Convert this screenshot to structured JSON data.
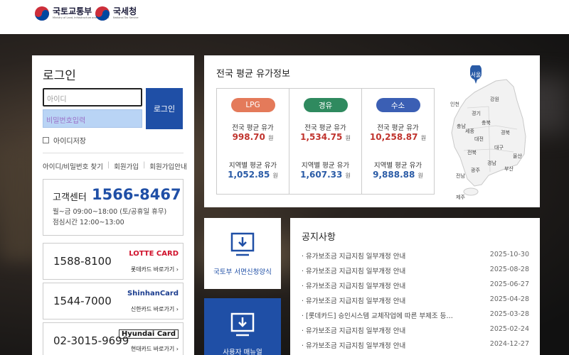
{
  "header": {
    "logo1": {
      "title": "국토교통부",
      "sub": "Ministry of Land, Infrastructure and Transport"
    },
    "logo2": {
      "title": "국세청",
      "sub": "National Tax Service"
    }
  },
  "login": {
    "title": "로그인",
    "id_placeholder": "아이디",
    "pw_placeholder": "비밀번호입력",
    "login_button": "로그인",
    "save_id_label": "아이디저장",
    "links": [
      "아이디/비밀번호 찾기",
      "회원가입",
      "회원가입안내"
    ]
  },
  "customer_center": {
    "label": "고객센터",
    "number": "1566-8467",
    "hours": "월~금 09:00~18:00 (토/공휴일 휴무)",
    "lunch": "점심시간 12:00~13:00"
  },
  "cards": [
    {
      "number": "1588-8100",
      "brand": "LOTTE CARD",
      "shortcut": "롯데카드 바로가기 ›",
      "color": "#d0112b"
    },
    {
      "number": "1544-7000",
      "brand": "ShinhanCard",
      "shortcut": "신한카드 바로가기 ›",
      "color": "#1a3c8e"
    },
    {
      "number": "02-3015-9699",
      "brand": "Hyundai Card",
      "shortcut": "현대카드 바로가기 ›",
      "color": "#111111"
    }
  ],
  "price": {
    "title": "전국 평균 유가정보",
    "fuels": [
      {
        "name": "LPG",
        "color": "#e47a5a",
        "national_label": "전국 평균 유가",
        "national_value": "998.70",
        "regional_label": "지역별 평균 유가",
        "regional_value": "1,052.85",
        "unit": "원"
      },
      {
        "name": "경유",
        "color": "#2f8a5f",
        "national_label": "전국 평균 유가",
        "national_value": "1,534.75",
        "regional_label": "지역별 평균 유가",
        "regional_value": "1,607.33",
        "unit": "원"
      },
      {
        "name": "수소",
        "color": "#3b5fb4",
        "national_label": "전국 평균 유가",
        "national_value": "10,258.87",
        "regional_label": "지역별 평균 유가",
        "regional_value": "9,888.88",
        "unit": "원"
      }
    ],
    "map": {
      "selected": "서울",
      "regions": [
        "인천",
        "강원",
        "경기",
        "충북",
        "충남",
        "세종",
        "대전",
        "경북",
        "대구",
        "전북",
        "울산",
        "광주",
        "경남",
        "부산",
        "전남",
        "제주"
      ]
    }
  },
  "tiles": [
    {
      "label": "국토부 서면신청양식",
      "icon": "download-monitor-icon"
    },
    {
      "label": "사용자 매뉴얼",
      "icon": "download-monitor-icon"
    }
  ],
  "notice": {
    "title": "공지사항",
    "items": [
      {
        "title": "유가보조금 지급지침 일부개정 안내",
        "date": "2025-10-30"
      },
      {
        "title": "유가보조금 지급지침 일부개정 안내",
        "date": "2025-08-28"
      },
      {
        "title": "유가보조금 지급지침 일부개정 안내",
        "date": "2025-06-27"
      },
      {
        "title": "유가보조금 지급지침 일부개정 안내",
        "date": "2025-04-28"
      },
      {
        "title": "[롯데카드] 승인시스템 교체작업에 따른 부제조 등…",
        "date": "2025-03-28"
      },
      {
        "title": "유가보조금 지급지침 일부개정 안내",
        "date": "2025-02-24"
      },
      {
        "title": "유가보조금 지급지침 일부개정 안내",
        "date": "2024-12-27"
      }
    ]
  }
}
